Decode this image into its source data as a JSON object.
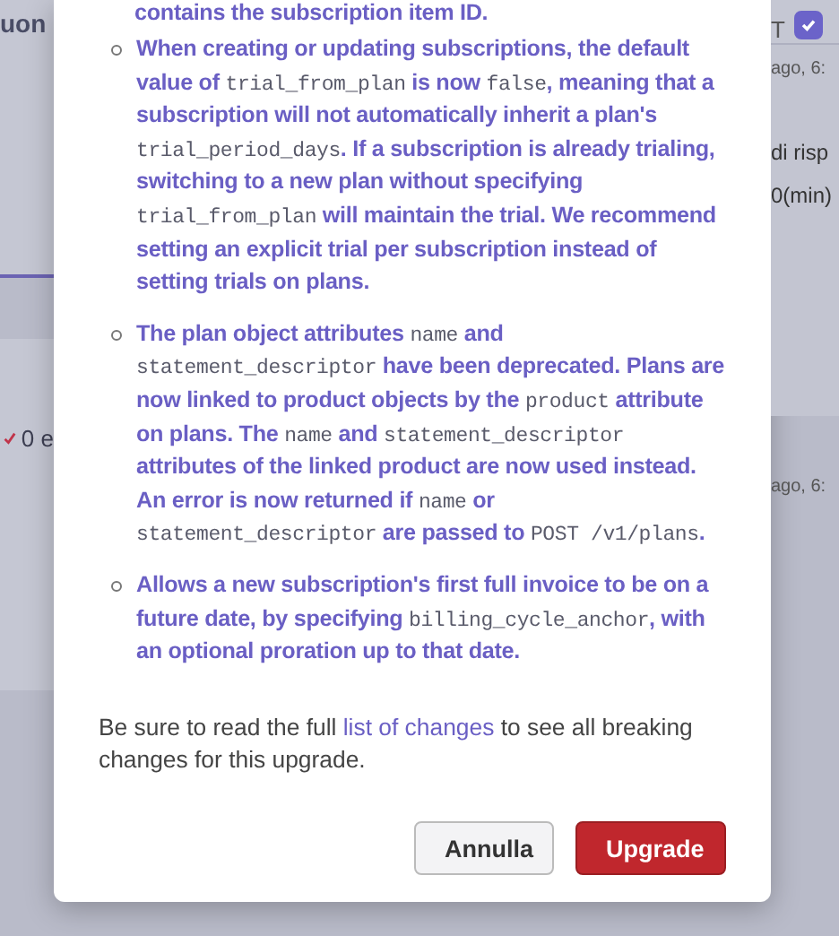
{
  "background": {
    "left_fragments": [
      {
        "text": "uon",
        "kind": "heading"
      },
      {
        "text": "0 e",
        "kind": "check"
      }
    ],
    "checkbox": {
      "checked": true
    },
    "right_fragments": [
      {
        "text": "ago, 6:",
        "kind": "time"
      },
      {
        "text": "di risp",
        "kind": "heading"
      },
      {
        "text": "0(min)",
        "kind": "value"
      },
      {
        "text": "ago, 6:",
        "kind": "time"
      }
    ],
    "right_letter": "T"
  },
  "modal": {
    "top_fragment": "contains the subscription item ID.",
    "list_items": [
      {
        "segments": [
          {
            "text": "When creating or updating subscriptions, the default value of ",
            "kind": "text"
          },
          {
            "text": "trial_from_plan",
            "kind": "code"
          },
          {
            "text": " is now ",
            "kind": "text"
          },
          {
            "text": "false",
            "kind": "code"
          },
          {
            "text": ", meaning that a subscription will not automatically inherit a plan's ",
            "kind": "text"
          },
          {
            "text": "trial_period_days",
            "kind": "code"
          },
          {
            "text": ". If a subscription is already trialing, switching to a new plan without specifying ",
            "kind": "text"
          },
          {
            "text": "trial_from_plan",
            "kind": "code"
          },
          {
            "text": " will maintain the trial. We recommend setting an explicit trial per subscription instead of setting trials on plans.",
            "kind": "text"
          }
        ]
      },
      {
        "segments": [
          {
            "text": "The plan object attributes ",
            "kind": "text"
          },
          {
            "text": "name",
            "kind": "code"
          },
          {
            "text": " and ",
            "kind": "text"
          },
          {
            "text": "statement_descriptor",
            "kind": "code"
          },
          {
            "text": " have been deprecated. Plans are now linked to product objects by the ",
            "kind": "text"
          },
          {
            "text": "product",
            "kind": "code"
          },
          {
            "text": " attribute on plans. The ",
            "kind": "text"
          },
          {
            "text": "name",
            "kind": "code"
          },
          {
            "text": " and ",
            "kind": "text"
          },
          {
            "text": "statement_descriptor",
            "kind": "code"
          },
          {
            "text": " attributes of the linked product are now used instead. An error is now returned if ",
            "kind": "text"
          },
          {
            "text": "name",
            "kind": "code"
          },
          {
            "text": " or ",
            "kind": "text"
          },
          {
            "text": "statement_descriptor",
            "kind": "code"
          },
          {
            "text": " are passed to ",
            "kind": "text"
          },
          {
            "text": "POST /v1/plans",
            "kind": "code"
          },
          {
            "text": ".",
            "kind": "text"
          }
        ]
      },
      {
        "segments": [
          {
            "text": "Allows a new subscription's first full invoice to be on a future date, by specifying ",
            "kind": "text"
          },
          {
            "text": "billing_cycle_anchor",
            "kind": "code"
          },
          {
            "text": ", with an optional proration up to that date.",
            "kind": "text"
          }
        ]
      }
    ],
    "note": {
      "before": "Be sure to read the full ",
      "link": "list of changes",
      "after": " to see all breaking changes for this upgrade."
    },
    "buttons": [
      {
        "label": "Annulla",
        "kind": "secondary"
      },
      {
        "label": "Upgrade",
        "kind": "primary"
      }
    ]
  }
}
